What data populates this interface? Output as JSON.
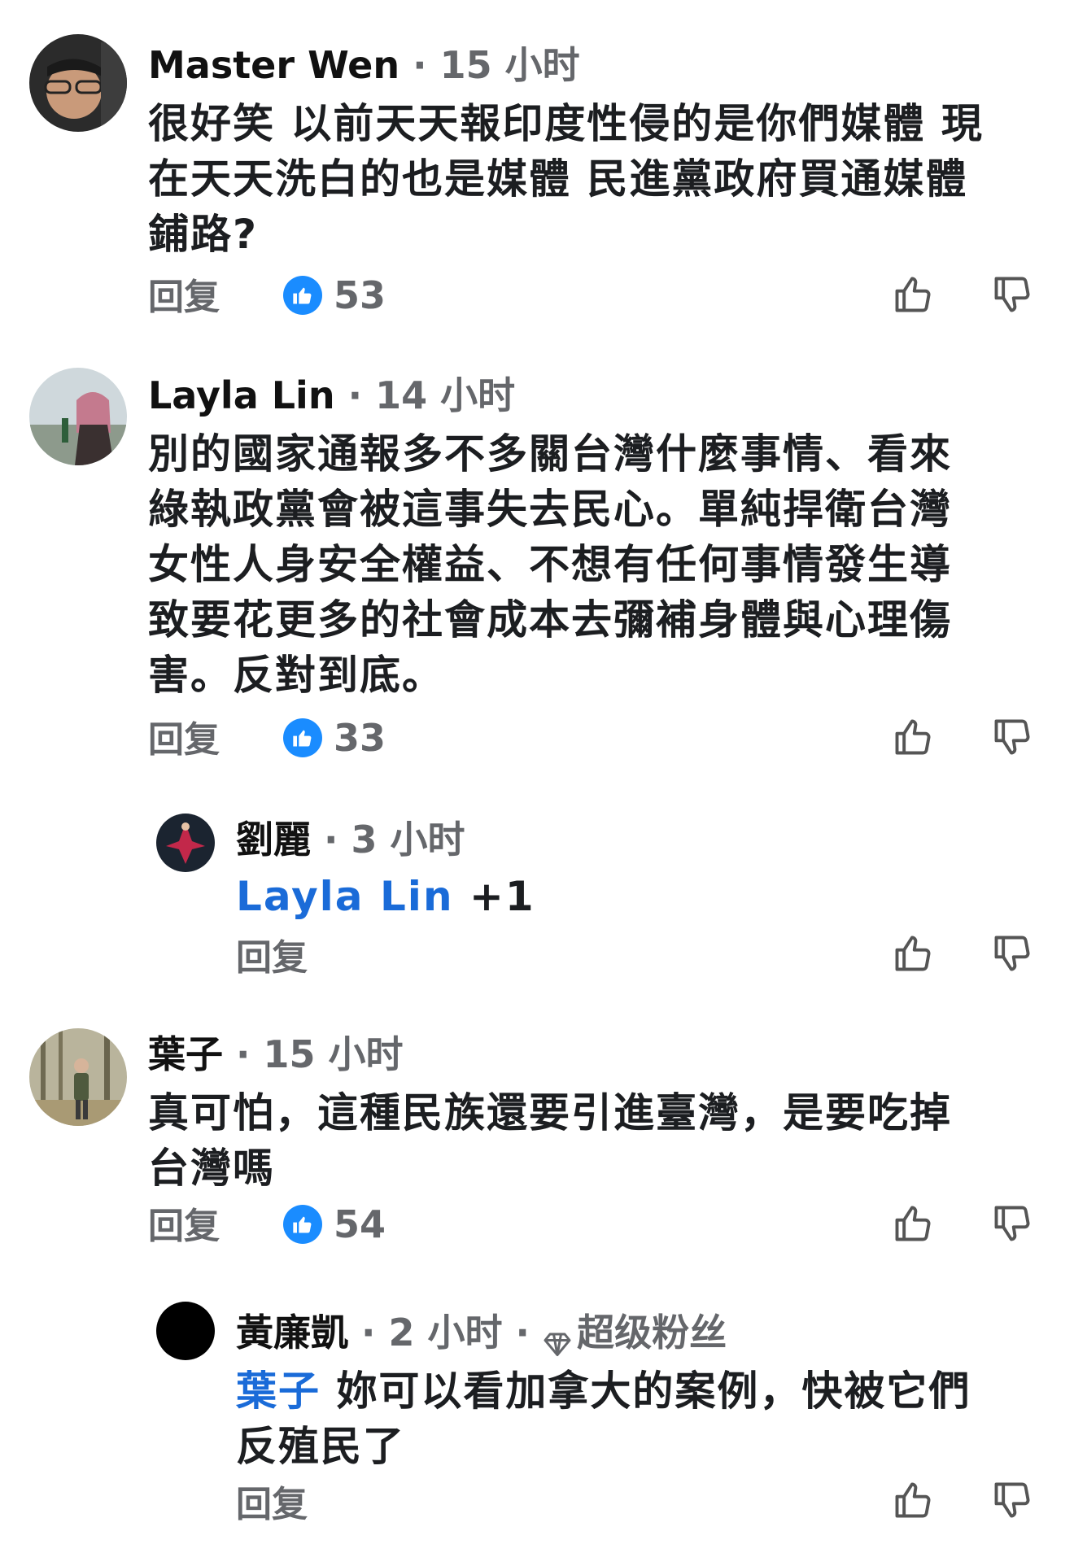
{
  "comments": [
    {
      "name": "Master Wen",
      "time": "15 小时",
      "lines": [
        "很好笑 以前天天報印度性侵的是你們媒體 現",
        "在天天洗白的也是媒體 民進黨政府買通媒體",
        "鋪路?"
      ],
      "reply": "回复",
      "likes": "53"
    },
    {
      "name": "Layla Lin",
      "time": "14 小时",
      "lines": [
        "別的國家通報多不多關台灣什麼事情、看來",
        "綠執政黨會被這事失去民心。單純捍衛台灣",
        "女性人身安全權益、不想有任何事情發生導",
        "致要花更多的社會成本去彌補身體與心理傷",
        "害。反對到底。"
      ],
      "reply": "回复",
      "likes": "33"
    },
    {
      "name": "劉麗",
      "time": "3 小时",
      "mention": "Layla Lin",
      "text_after_mention": "+1",
      "reply": "回复"
    },
    {
      "name": "葉子",
      "time": "15 小时",
      "lines": [
        "真可怕，這種民族還要引進臺灣，是要吃掉",
        "台灣嗎"
      ],
      "reply": "回复",
      "likes": "54"
    },
    {
      "name": "黃廉凱",
      "time": "2 小时",
      "badge": "超级粉丝",
      "mention": "葉子",
      "line1_rest": "妳可以看加拿大的案例，快被它們",
      "line2": "反殖民了",
      "reply": "回复"
    }
  ],
  "separator": " · ",
  "icons": {
    "like": "thumbs-up-icon",
    "dislike": "thumbs-down-icon",
    "badge": "diamond-icon",
    "like_badge": "blue-like-badge-icon"
  },
  "colors": {
    "accent": "#1a8cff",
    "mention": "#1a6bd8",
    "muted": "#65676b"
  }
}
